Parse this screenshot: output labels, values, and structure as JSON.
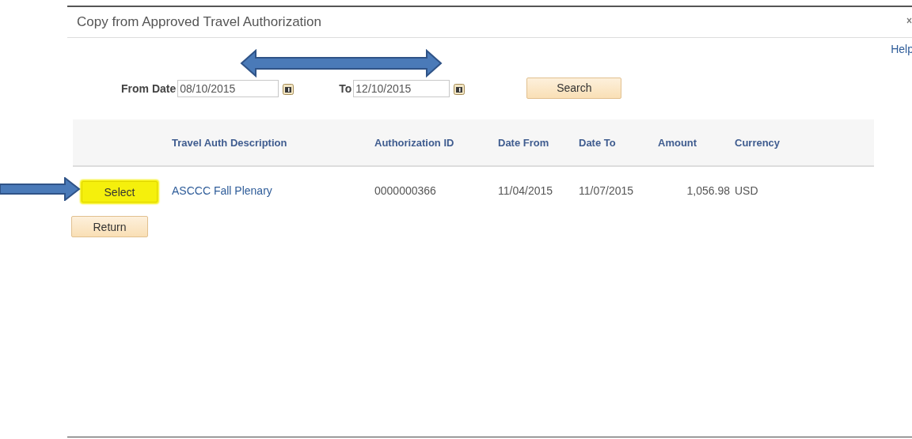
{
  "dialog": {
    "title": "Copy from Approved Travel Authorization",
    "help_link": "Help"
  },
  "filters": {
    "from_label": "From Date",
    "from_value": "08/10/2015",
    "to_label": "To",
    "to_value": "12/10/2015",
    "search_button": "Search"
  },
  "table": {
    "columns": [
      "",
      "Travel Auth Description",
      "Authorization ID",
      "Date From",
      "Date To",
      "Amount",
      "Currency"
    ],
    "rows": [
      {
        "button": "Select",
        "button_highlighted": true,
        "description": "ASCCC Fall Plenary",
        "authorization_id": "0000000366",
        "date_from": "11/04/2015",
        "date_to": "11/07/2015",
        "amount": "1,056.98",
        "currency": "USD"
      }
    ]
  },
  "return_button": "Return",
  "annotations": [
    {
      "kind": "double-arrow"
    },
    {
      "kind": "right-arrow"
    }
  ]
}
